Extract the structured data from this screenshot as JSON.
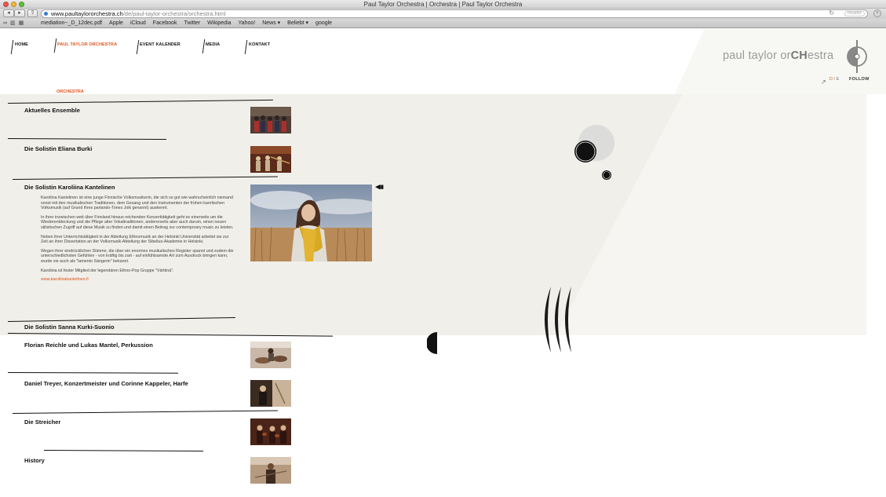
{
  "browser": {
    "window_title": "Paul Taylor Orchestra | Orchestra | Paul Taylor Orchestra",
    "url_domain": "www.paultaylororchestra.ch",
    "url_path": "/de/paul-taylor-orchestra/orchestra.html",
    "reader_label": "Reader",
    "bookmarks": [
      "mediation~_D_12dec.pdf",
      "Apple",
      "iCloud",
      "Facebook",
      "Twitter",
      "Wikipedia",
      "Yahoo!",
      "News ▾",
      "Beliebt ▾",
      "google"
    ]
  },
  "nav": {
    "items": [
      {
        "label": "HOME",
        "active": false
      },
      {
        "label": "PAUL TAYLOR ORCHESTRA",
        "active": true
      },
      {
        "label": "EVENT KALENDER",
        "active": false
      },
      {
        "label": "MEDIA",
        "active": false
      },
      {
        "label": "KONTAKT",
        "active": false
      }
    ]
  },
  "header": {
    "logo_light": "paul taylor or",
    "logo_strong": "CH",
    "logo_tail": "estra",
    "follow_label": "FOLLOW",
    "lang_active": "D",
    "lang_sep": " / ",
    "lang_other": "E"
  },
  "section": {
    "label": "ORCHESTRA"
  },
  "items": [
    {
      "title": "Aktuelles Ensemble"
    },
    {
      "title": "Die Solistin Eliana Burki"
    },
    {
      "title": "Die Solistin Karoliina Kantelinen"
    },
    {
      "title": "Die Solistin Sanna Kurki-Suonio"
    },
    {
      "title": "Florian Reichle und Lukas Mantel, Perkussion"
    },
    {
      "title": "Daniel Treyer, Konzertmeister und Corinne Kappeler, Harfe"
    },
    {
      "title": "Die Streicher"
    },
    {
      "title": "History"
    }
  ],
  "bio": {
    "p1": "Karoliina Kantelinen ist eine junge Finnische Volksmusikerin, die sich so gut wie wahrscheinlich niemand sonst mit den musikalischen Traditionen, dem Gesang und den Instrumenten der frühen karelischen Volksmusik (auf Grund ihres parlando-Tones Joik genannt) auskennt.",
    "p2": "In ihrer inzwischen weit über Finnland hinaus reichenden Konzerttätigkeit geht es einerseits um die Wiederentdeckung und die Pflege alter Vokaltraditionen, andererseits aber auch darum, einen neuen stilistischen Zugriff auf diese Musik zu finden und damit einen Beitrag zur contemporary music zu leisten.",
    "p3": "Neben ihrer Unterrichtstätigkeit in der Abteilung Ethnomusik an der Helsinki Universität arbeitet sie zur Zeit an ihrer Dissertation an der Volksmusik-Abteilung der Sibelius-Akademie in Helsinki.",
    "p4": "Wegen ihrer eindrücklichen Stimme, die über ein enormes musikalisches Register spannt und zudem die unterschiedlichsten Gefühlen - von kräftig bis zart - auf einfühlsamste Art zum Ausdruck bringen kann, wurde sie auch als \"lamento Sängerin\" bekannt.",
    "p5": "Karoliina ist fester Mitglied der legendären Ethno-Pop Gruppe \"Värttinä\".",
    "link": "www.karoliinakantelinen.fi"
  },
  "gallery": {
    "controls": "◀▮▮"
  },
  "colors": {
    "accent": "#e2531b",
    "band": "#f0efea",
    "text": "#111111"
  }
}
